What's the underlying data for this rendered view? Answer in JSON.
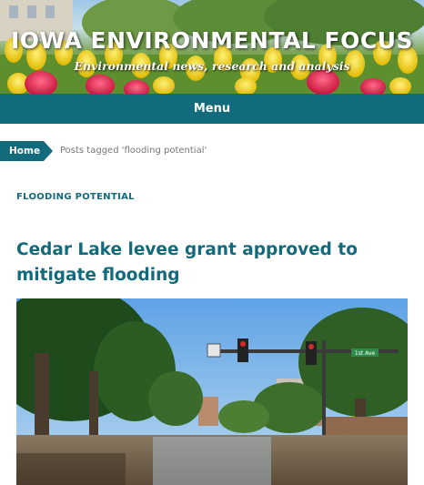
{
  "header": {
    "site_title": "IOWA ENVIRONMENTAL FOCUS",
    "tagline": "Environmental news, research and analysis"
  },
  "nav": {
    "menu_label": "Menu"
  },
  "breadcrumb": {
    "home_label": "Home",
    "current": "Posts tagged 'flooding potential'"
  },
  "archive": {
    "category_label": "FLOODING POTENTIAL"
  },
  "post": {
    "title": "Cedar Lake levee grant approved to mitigate flooding",
    "image_signs": {
      "street_sign": "1st Ave"
    }
  },
  "colors": {
    "brand_teal": "#126a7d",
    "muted_text": "#777777"
  }
}
